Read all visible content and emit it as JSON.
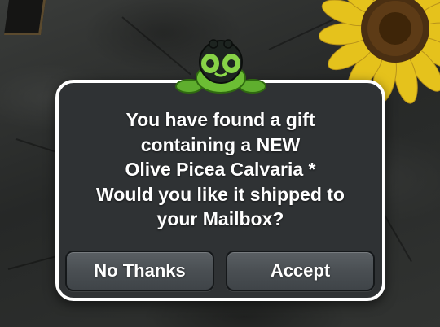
{
  "dialog": {
    "message_lines": [
      "You have found a gift",
      "containing a NEW",
      "Olive Picea Calvaria *",
      "Would you like it shipped to",
      "your Mailbox?"
    ],
    "decline_label": "No Thanks",
    "accept_label": "Accept"
  },
  "icons": {
    "mascot": "frog-mascot-icon",
    "sunflower": "sunflower-icon",
    "film": "film-strip-icon"
  },
  "colors": {
    "dialog_bg": "#2f3234",
    "dialog_border": "#ffffff",
    "button_bg": "#4a4f53",
    "text": "#ffffff",
    "mascot_green": "#5fae2e"
  }
}
